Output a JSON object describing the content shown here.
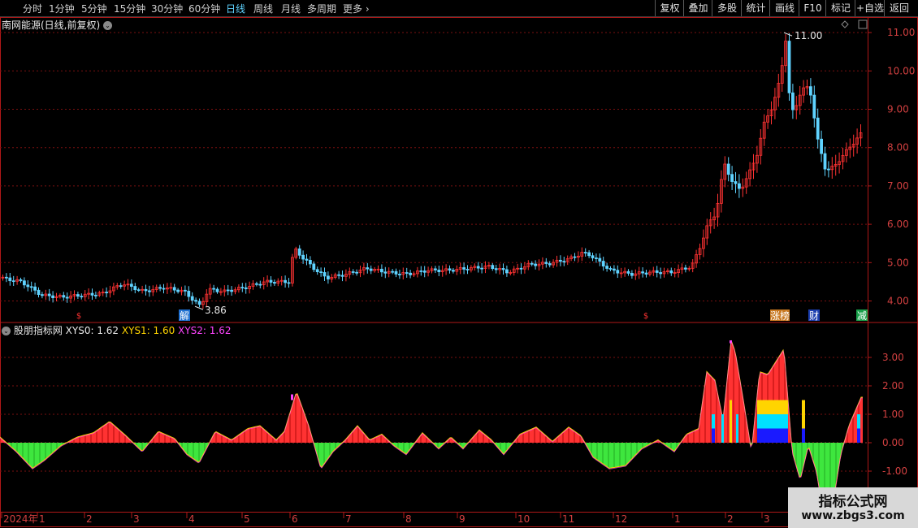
{
  "toolbar": {
    "periods": [
      "分时",
      "1分钟",
      "5分钟",
      "15分钟",
      "30分钟",
      "60分钟",
      "日线",
      "周线",
      "月线",
      "多周期",
      "更多"
    ],
    "active_period": "日线",
    "right_buttons": [
      "复权",
      "叠加",
      "多股",
      "统计",
      "画线",
      "F10",
      "标记",
      "+自选",
      "返回"
    ]
  },
  "price_panel": {
    "title": "南网能源(日线,前复权)",
    "high_label": "11.00",
    "low_label": "3.86",
    "axis_ticks": [
      "11.00",
      "10.00",
      "9.00",
      "8.00",
      "7.00",
      "6.00",
      "5.00",
      "4.00"
    ],
    "markers": [
      "解",
      "涨榜",
      "财",
      "减"
    ]
  },
  "indicator_panel": {
    "name": "股朋指标网",
    "xys0_label": "XYS0: 1.62",
    "xys1_label": "XYS1: 1.60",
    "xys2_label": "XYS2: 1.62",
    "axis_ticks": [
      "3.00",
      "2.00",
      "1.00",
      "0.00",
      "-1.00"
    ]
  },
  "time_axis": {
    "labels": [
      "2024年",
      "1",
      "2",
      "3",
      "4",
      "5",
      "6",
      "7",
      "8",
      "9",
      "10",
      "11",
      "12",
      "1",
      "2",
      "3"
    ]
  },
  "watermark": {
    "title": "指标公式网",
    "url": "www.zbgs3.com"
  },
  "colors": {
    "up": "#ff3232",
    "down": "#5fd3ff",
    "grid": "#7a1010",
    "green": "#3ee63e",
    "yellow": "#ffd400",
    "blue": "#1a1aff",
    "cyan": "#00e0ff",
    "magenta": "#ff44ff"
  },
  "chart_data": {
    "type": "line",
    "series": [
      {
        "name": "price",
        "x": [
          0,
          25,
          50,
          75,
          100,
          125,
          150,
          175,
          200,
          225,
          245,
          255,
          275,
          300,
          325,
          340,
          355,
          360,
          370,
          385,
          400,
          425,
          450,
          475,
          500,
          525,
          550,
          575,
          600,
          625,
          650,
          675,
          700,
          715,
          725,
          750,
          775,
          800,
          825,
          850,
          860,
          870,
          880,
          890,
          900,
          910,
          920,
          930,
          940,
          950,
          960,
          965,
          970,
          975,
          985,
          995,
          1005,
          1015,
          1025,
          1040,
          1060
        ],
        "y": [
          4.6,
          4.5,
          4.15,
          4.1,
          4.15,
          4.2,
          4.45,
          4.25,
          4.35,
          4.25,
          3.86,
          4.3,
          4.25,
          4.35,
          4.5,
          4.5,
          4.5,
          5.4,
          5.15,
          4.85,
          4.6,
          4.7,
          4.85,
          4.75,
          4.7,
          4.8,
          4.8,
          4.85,
          4.9,
          4.75,
          4.95,
          4.98,
          5.1,
          5.25,
          5.2,
          4.8,
          4.7,
          4.75,
          4.75,
          4.9,
          5.4,
          6.0,
          6.3,
          7.6,
          7.1,
          6.9,
          7.3,
          7.8,
          8.7,
          9.1,
          9.9,
          11.0,
          9.4,
          8.9,
          9.5,
          9.6,
          8.2,
          7.4,
          7.5,
          7.9,
          8.4
        ]
      },
      {
        "name": "indicator",
        "x": [
          0,
          20,
          40,
          55,
          75,
          95,
          115,
          135,
          155,
          175,
          195,
          215,
          230,
          245,
          265,
          285,
          305,
          320,
          340,
          350,
          365,
          380,
          395,
          410,
          425,
          440,
          455,
          470,
          485,
          500,
          520,
          540,
          555,
          570,
          590,
          605,
          620,
          640,
          660,
          680,
          700,
          715,
          730,
          750,
          770,
          790,
          810,
          830,
          845,
          860,
          870,
          880,
          890,
          900,
          905,
          915,
          925,
          935,
          945,
          965,
          975,
          985,
          995,
          1005,
          1015,
          1025,
          1035,
          1045,
          1060
        ],
        "y": [
          0.2,
          -0.3,
          -0.9,
          -0.6,
          -0.1,
          0.2,
          0.35,
          0.75,
          0.25,
          -0.3,
          0.4,
          0.15,
          -0.4,
          -0.7,
          0.4,
          0.1,
          0.5,
          0.6,
          0.1,
          0.4,
          1.8,
          0.6,
          -0.9,
          -0.3,
          0.1,
          0.6,
          0.1,
          0.3,
          -0.1,
          -0.4,
          0.35,
          -0.2,
          0.2,
          -0.2,
          0.45,
          0.1,
          -0.4,
          0.3,
          0.55,
          0.05,
          0.55,
          0.25,
          -0.5,
          -0.9,
          -0.8,
          -0.2,
          0.1,
          -0.3,
          0.3,
          0.5,
          2.5,
          2.2,
          0.8,
          3.6,
          3.2,
          1.5,
          -0.3,
          2.5,
          2.4,
          3.3,
          -0.3,
          -1.3,
          -0.1,
          -1.0,
          -2.8,
          -2.2,
          -0.4,
          0.6,
          1.6
        ]
      }
    ]
  }
}
